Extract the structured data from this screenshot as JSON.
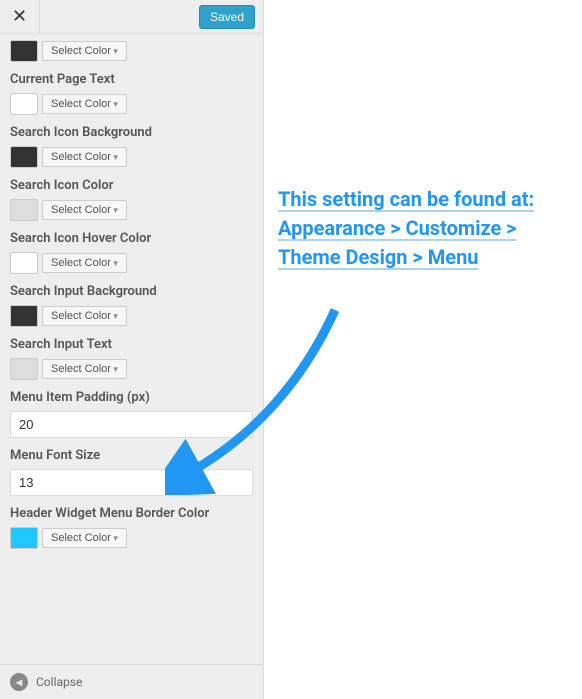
{
  "header": {
    "saved_label": "Saved"
  },
  "controls": {
    "select_color_label": "Select Color",
    "color0": {
      "swatch": "#333333"
    },
    "current_page_text": {
      "label": "Current Page Text",
      "swatch": "#ffffff"
    },
    "search_icon_bg": {
      "label": "Search Icon Background",
      "swatch": "#333333"
    },
    "search_icon_color": {
      "label": "Search Icon Color",
      "swatch": "#dddddd"
    },
    "search_icon_hover": {
      "label": "Search Icon Hover Color",
      "swatch": "#ffffff"
    },
    "search_input_bg": {
      "label": "Search Input Background",
      "swatch": "#333333"
    },
    "search_input_text": {
      "label": "Search Input Text",
      "swatch": "#dddddd"
    },
    "menu_item_padding": {
      "label": "Menu Item Padding (px)",
      "value": "20"
    },
    "menu_font_size": {
      "label": "Menu Font Size",
      "value": "13"
    },
    "header_widget_border": {
      "label": "Header Widget Menu Border Color",
      "swatch": "#1ec7ff"
    }
  },
  "footer": {
    "collapse_label": "Collapse"
  },
  "annotation": {
    "text": "This setting can be found at:\nAppearance > Customize > Theme Design > Menu"
  }
}
